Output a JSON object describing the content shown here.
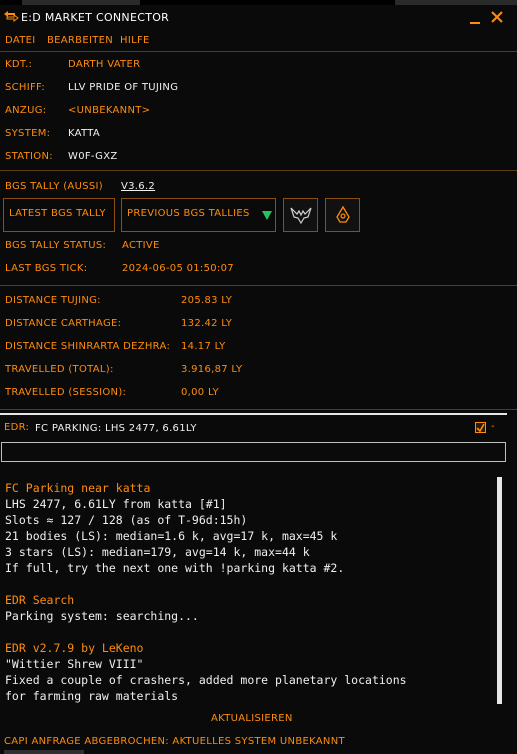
{
  "window": {
    "title": "E:D MARKET CONNECTOR",
    "minimize_glyph": "_",
    "close_glyph": "✕"
  },
  "menu": [
    "DATEI",
    "BEARBEITEN",
    "HILFE"
  ],
  "commander": {
    "rows": [
      {
        "label": "KDT.:",
        "value": "DARTH VATER",
        "orange": true
      },
      {
        "label": "SCHIFF:",
        "value": "LLV PRIDE OF TUJING",
        "orange": false
      },
      {
        "label": "ANZUG:",
        "value": "<UNBEKANNT>",
        "orange": true
      },
      {
        "label": "SYSTEM:",
        "value": "KATTA",
        "orange": false
      },
      {
        "label": "STATION:",
        "value": "W0F-GXZ",
        "orange": false
      }
    ]
  },
  "bgs": {
    "title": "BGS TALLY (AUSSI)",
    "version": "V3.6.2",
    "latest_button": "LATEST BGS TALLY",
    "previous_button": "PREVIOUS BGS TALLIES",
    "status_label": "BGS TALLY STATUS:",
    "status_value": "ACTIVE",
    "tick_label": "LAST BGS TICK:",
    "tick_value": "2024-06-05 01:50:07"
  },
  "distances": [
    {
      "label": "DISTANCE TUJING:",
      "value": "205.83 LY"
    },
    {
      "label": "DISTANCE CARTHAGE:",
      "value": "132.42 LY"
    },
    {
      "label": "DISTANCE SHINRARTA DEZHRA:",
      "value": "14.17 LY"
    },
    {
      "label": "TRAVELLED (TOTAL):",
      "value": "3.916,87 LY"
    },
    {
      "label": "TRAVELLED (SESSION):",
      "value": "0,00 LY"
    }
  ],
  "edr": {
    "label": "EDR:",
    "value": "FC PARKING: LHS 2477, 6.61LY",
    "dash": "-",
    "input_value": ""
  },
  "console": [
    {
      "text": "FC Parking near katta",
      "style": "h"
    },
    {
      "text": "LHS 2477, 6.61LY from katta [#1]",
      "style": "t"
    },
    {
      "text": "Slots ≈ 127 / 128 (as of T-96d:15h)",
      "style": "t"
    },
    {
      "text": "21 bodies (LS): median=1.6 k, avg=17 k, max=45 k",
      "style": "t"
    },
    {
      "text": "3 stars (LS): median=179, avg=14 k, max=44 k",
      "style": "t"
    },
    {
      "text": "If full, try the next one with !parking katta #2.",
      "style": "t"
    },
    {
      "text": "",
      "style": "t"
    },
    {
      "text": "EDR Search",
      "style": "h"
    },
    {
      "text": "Parking system: searching...",
      "style": "t"
    },
    {
      "text": "",
      "style": "t"
    },
    {
      "text": "EDR v2.7.9 by LeKeno",
      "style": "h"
    },
    {
      "text": "\"Wittier Shrew VIII\"",
      "style": "t"
    },
    {
      "text": "Fixed a couple of crashers, added more planetary locations",
      "style": "t"
    },
    {
      "text": "for farming raw materials",
      "style": "t"
    }
  ],
  "update_button": "AKTUALISIEREN",
  "status": "CAPI ANFRAGE ABGEBROCHEN: AKTUELLES SYSTEM UNBEKANNT",
  "colors": {
    "accent": "#ff8c0d",
    "text": "#f0f0f0",
    "background": "#0a0a0a",
    "success": "#22c55e"
  },
  "icons": [
    "app-icon",
    "eagle-icon",
    "alien-icon",
    "dropdown-triangle-icon",
    "checkbox-icon"
  ]
}
